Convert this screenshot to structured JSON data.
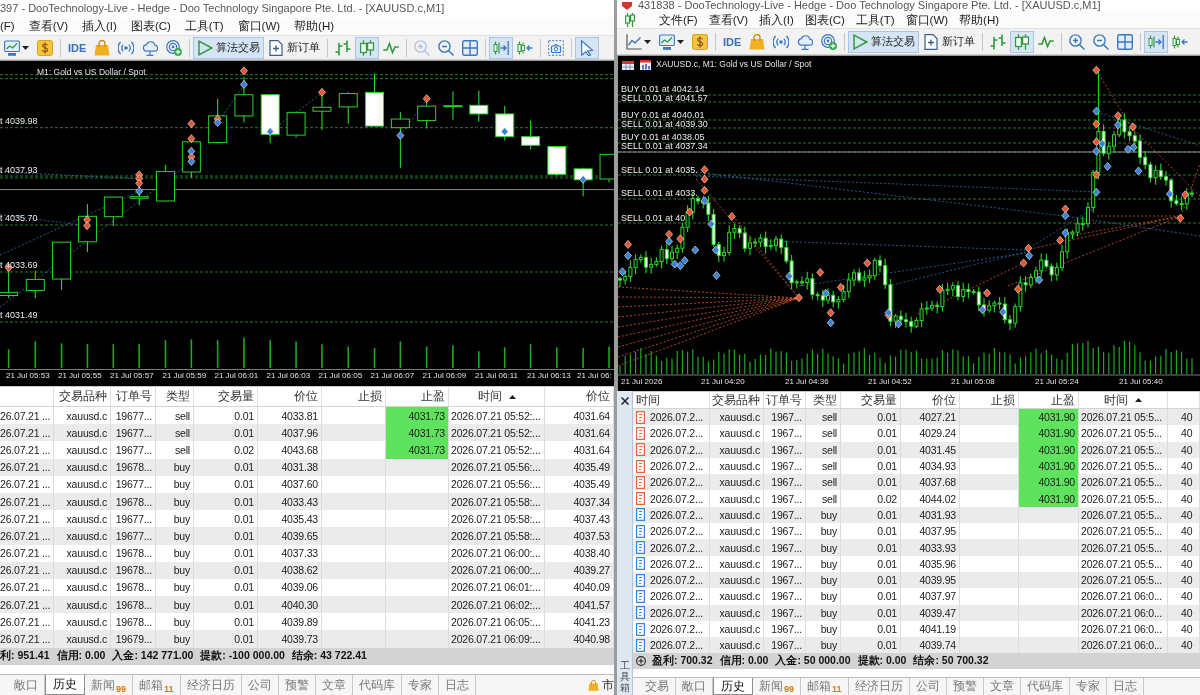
{
  "left_window": {
    "title": "397 - DooTechnology-Live - Hedge - Doo Technology Singapore Pte. Ltd. - [XAUUSD.c,M1]",
    "menu": [
      "(F)",
      "查看(V)",
      "插入(I)",
      "图表(C)",
      "工具(T)",
      "窗口(W)",
      "帮助(H)"
    ],
    "toolbar": [
      [
        {
          "selected": false,
          "disabled": false
        },
        {
          "selected": false,
          "disabled": false
        }
      ],
      [
        {
          "label": "IDE",
          "selected": false,
          "disabled": false
        },
        {
          "selected": false,
          "disabled": false
        },
        {
          "selected": false,
          "disabled": false
        },
        {
          "selected": false,
          "disabled": false
        },
        {
          "selected": false,
          "disabled": false
        }
      ],
      [
        {
          "label": "算法交易",
          "selected": true,
          "disabled": false
        },
        {
          "label": "新订单",
          "selected": false,
          "disabled": false
        }
      ],
      [
        {
          "selected": false,
          "disabled": false
        },
        {
          "selected": true,
          "disabled": false
        },
        {
          "selected": false,
          "disabled": false
        }
      ],
      [
        {
          "selected": false,
          "disabled": true
        },
        {
          "selected": false,
          "disabled": false
        },
        {
          "selected": false,
          "disabled": false
        }
      ],
      [
        {
          "selected": true,
          "disabled": false
        },
        {
          "selected": false,
          "disabled": false
        }
      ],
      [
        {
          "selected": false,
          "disabled": false
        }
      ],
      [
        {
          "selected": true,
          "disabled": false
        }
      ]
    ],
    "chart": {
      "title": "M1: Gold vs US Dollar / Spot",
      "order_labels": [
        "t 4039.98",
        "t 4037.93",
        "t 4035.70",
        "t 4033.69",
        "t 4031.49"
      ],
      "time_labels": [
        "21 Jul 05:53",
        "21 Jul 05:55",
        "21 Jul 05:57",
        "21 Jul 05:59",
        "21 Jul 06:01",
        "21 Jul 06:03",
        "21 Jul 06:05",
        "21 Jul 06:07",
        "21 Jul 06:09",
        "21 Jul 06:11",
        "21 Jul 06:13",
        "21 Jul 06:"
      ]
    },
    "table": {
      "columns": [
        {
          "sorted": false
        },
        {
          "label": "交易品种",
          "sorted": false
        },
        {
          "label": "订单号",
          "sorted": false
        },
        {
          "label": "类型",
          "sorted": false
        },
        {
          "label": "交易量",
          "sorted": false
        },
        {
          "label": "价位",
          "sorted": false
        },
        {
          "label": "止损",
          "sorted": false
        },
        {
          "label": "止盈",
          "sorted": false
        },
        {
          "label": "时间",
          "sorted": true
        },
        {
          "label": "价位",
          "sorted": false
        }
      ],
      "rows": [
        {
          "time": "26.07.21 ...",
          "symbol": "xauusd.c",
          "order": "19677...",
          "type": "sell",
          "volume": "0.01",
          "price": "4033.81",
          "take_profit": "4031.73",
          "tp_highlighted": true,
          "close_time": "2026.07.21 05:52:...",
          "close_price": "4031.64"
        },
        {
          "time": "26.07.21 ...",
          "symbol": "xauusd.c",
          "order": "19677...",
          "type": "sell",
          "volume": "0.01",
          "price": "4037.96",
          "take_profit": "4031.73",
          "tp_highlighted": true,
          "close_time": "2026.07.21 05:52:...",
          "close_price": "4031.64"
        },
        {
          "time": "26.07.21 ...",
          "symbol": "xauusd.c",
          "order": "19677...",
          "type": "sell",
          "volume": "0.02",
          "price": "4043.68",
          "take_profit": "4031.73",
          "tp_highlighted": true,
          "close_time": "2026.07.21 05:52:...",
          "close_price": "4031.64"
        },
        {
          "time": "26.07.21 ...",
          "symbol": "xauusd.c",
          "order": "19678...",
          "type": "buy",
          "volume": "0.01",
          "price": "4031.38",
          "tp_highlighted": false,
          "close_time": "2026.07.21 05:56:...",
          "close_price": "4035.49"
        },
        {
          "time": "26.07.21 ...",
          "symbol": "xauusd.c",
          "order": "19677...",
          "type": "buy",
          "volume": "0.01",
          "price": "4037.60",
          "tp_highlighted": false,
          "close_time": "2026.07.21 05:56:...",
          "close_price": "4035.49"
        },
        {
          "time": "26.07.21 ...",
          "symbol": "xauusd.c",
          "order": "19678...",
          "type": "buy",
          "volume": "0.01",
          "price": "4033.43",
          "tp_highlighted": false,
          "close_time": "2026.07.21 05:58:...",
          "close_price": "4037.34"
        },
        {
          "time": "26.07.21 ...",
          "symbol": "xauusd.c",
          "order": "19677...",
          "type": "buy",
          "volume": "0.01",
          "price": "4035.43",
          "tp_highlighted": false,
          "close_time": "2026.07.21 05:58:...",
          "close_price": "4037.43"
        },
        {
          "time": "26.07.21 ...",
          "symbol": "xauusd.c",
          "order": "19677...",
          "type": "buy",
          "volume": "0.01",
          "price": "4039.65",
          "tp_highlighted": false,
          "close_time": "2026.07.21 05:58:...",
          "close_price": "4037.53"
        },
        {
          "time": "26.07.21 ...",
          "symbol": "xauusd.c",
          "order": "19678...",
          "type": "buy",
          "volume": "0.01",
          "price": "4037.33",
          "tp_highlighted": false,
          "close_time": "2026.07.21 06:00:...",
          "close_price": "4038.40"
        },
        {
          "time": "26.07.21 ...",
          "symbol": "xauusd.c",
          "order": "19678...",
          "type": "buy",
          "volume": "0.01",
          "price": "4038.62",
          "tp_highlighted": false,
          "close_time": "2026.07.21 06:00:...",
          "close_price": "4039.27"
        },
        {
          "time": "26.07.21 ...",
          "symbol": "xauusd.c",
          "order": "19678...",
          "type": "buy",
          "volume": "0.01",
          "price": "4039.06",
          "tp_highlighted": false,
          "close_time": "2026.07.21 06:01:...",
          "close_price": "4040.09"
        },
        {
          "time": "26.07.21 ...",
          "symbol": "xauusd.c",
          "order": "19678...",
          "type": "buy",
          "volume": "0.01",
          "price": "4040.30",
          "tp_highlighted": false,
          "close_time": "2026.07.21 06:02:...",
          "close_price": "4041.57"
        },
        {
          "time": "26.07.21 ...",
          "symbol": "xauusd.c",
          "order": "19678...",
          "type": "buy",
          "volume": "0.01",
          "price": "4039.89",
          "tp_highlighted": false,
          "close_time": "2026.07.21 06:05:...",
          "close_price": "4041.23"
        },
        {
          "time": "26.07.21 ...",
          "symbol": "xauusd.c",
          "order": "19679...",
          "type": "buy",
          "volume": "0.01",
          "price": "4039.73",
          "tp_highlighted": false,
          "close_time": "2026.07.21 06:09:...",
          "close_price": "4040.98"
        }
      ],
      "summary": [
        "利: 951.41",
        "信用: 0.00",
        "入金: 142 771.00",
        "提款: -100 000.00",
        "结余: 43 722.41"
      ]
    },
    "tabs": [
      {
        "label": "敞口",
        "selected": false
      },
      {
        "label": "历史",
        "selected": true
      },
      {
        "label": "新闻",
        "badge": "99",
        "selected": false
      },
      {
        "label": "邮箱",
        "badge": "11",
        "selected": false
      },
      {
        "label": "经济日历",
        "selected": false
      },
      {
        "label": "公司",
        "selected": false
      },
      {
        "label": "预警",
        "selected": false
      },
      {
        "label": "文章",
        "selected": false
      },
      {
        "label": "代码库",
        "selected": false
      },
      {
        "label": "专家",
        "selected": false
      },
      {
        "label": "日志",
        "selected": false
      }
    ],
    "status": "市"
  },
  "right_window": {
    "title": "431838 - DooTechnology-Live - Hedge - Doo Technology Singapore Pte. Ltd. - [XAUUSD.c,M1]",
    "menu": [
      "文件(F)",
      "查看(V)",
      "插入(I)",
      "图表(C)",
      "工具(T)",
      "窗口(W)",
      "帮助(H)"
    ],
    "toolbar": [
      [
        {
          "selected": false,
          "disabled": false
        },
        {
          "selected": false,
          "disabled": false
        },
        {
          "selected": false,
          "disabled": false
        }
      ],
      [
        {
          "label": "IDE",
          "selected": false,
          "disabled": false
        },
        {
          "selected": false,
          "disabled": false
        },
        {
          "selected": false,
          "disabled": false
        },
        {
          "selected": false,
          "disabled": false
        },
        {
          "selected": false,
          "disabled": false
        }
      ],
      [
        {
          "label": "算法交易",
          "selected": true,
          "disabled": false
        },
        {
          "label": "新订单",
          "selected": false,
          "disabled": false
        }
      ],
      [
        {
          "selected": false,
          "disabled": false
        },
        {
          "selected": true,
          "disabled": false
        },
        {
          "selected": false,
          "disabled": false
        }
      ],
      [
        {
          "selected": false,
          "disabled": false
        },
        {
          "selected": false,
          "disabled": false
        },
        {
          "selected": false,
          "disabled": false
        }
      ],
      [
        {
          "selected": true,
          "disabled": false
        },
        {
          "selected": false,
          "disabled": false
        }
      ]
    ],
    "chart": {
      "title": "XAUUSD.c, M1: Gold vs US Dollar / Spot",
      "order_labels": [
        "BUY 0.01 at 4042.14",
        "SELL 0.01 at 4041.57",
        "BUY 0.01 at 4040.01",
        "SELL 0.01 at 4039.30",
        "BUY 0.01 at 4038.05",
        "SELL 0.01 at 4037.34",
        "SELL 0.01 at 4035.",
        "SELL 0.01 at 4033.",
        "SELL 0.01 at 40"
      ],
      "time_labels": [
        "21 Jul 2026",
        "21 Jul 04:20",
        "21 Jul 04:36",
        "21 Jul 04:52",
        "21 Jul 05:08",
        "21 Jul 05:24",
        "21 Jul 05:40"
      ]
    },
    "table": {
      "columns": [
        {
          "label": "时间",
          "sorted": false
        },
        {
          "label": "交易品种",
          "sorted": false
        },
        {
          "label": "订单号",
          "sorted": false
        },
        {
          "label": "类型",
          "sorted": false
        },
        {
          "label": "交易量",
          "sorted": false
        },
        {
          "label": "价位",
          "sorted": false
        },
        {
          "label": "止损",
          "sorted": false
        },
        {
          "label": "止盈",
          "sorted": false
        },
        {
          "label": "时间",
          "sorted": true
        },
        {
          "sorted": false
        }
      ],
      "rows": [
        {
          "kind": "sell",
          "time": "2026.07.2...",
          "symbol": "xauusd.c",
          "order": "1967...",
          "type": "sell",
          "volume": "0.01",
          "price": "4027.21",
          "take_profit": "4031.90",
          "tp_highlighted": true,
          "close_time": "2026.07.21 05:5...",
          "close_price": "40"
        },
        {
          "kind": "sell",
          "time": "2026.07.2...",
          "symbol": "xauusd.c",
          "order": "1967...",
          "type": "sell",
          "volume": "0.01",
          "price": "4029.24",
          "take_profit": "4031.90",
          "tp_highlighted": true,
          "close_time": "2026.07.21 05:5...",
          "close_price": "40"
        },
        {
          "kind": "sell",
          "time": "2026.07.2...",
          "symbol": "xauusd.c",
          "order": "1967...",
          "type": "sell",
          "volume": "0.01",
          "price": "4031.45",
          "take_profit": "4031.90",
          "tp_highlighted": true,
          "close_time": "2026.07.21 05:5...",
          "close_price": "40"
        },
        {
          "kind": "sell",
          "time": "2026.07.2...",
          "symbol": "xauusd.c",
          "order": "1967...",
          "type": "sell",
          "volume": "0.01",
          "price": "4034.93",
          "take_profit": "4031.90",
          "tp_highlighted": true,
          "close_time": "2026.07.21 05:5...",
          "close_price": "40"
        },
        {
          "kind": "sell",
          "time": "2026.07.2...",
          "symbol": "xauusd.c",
          "order": "1967...",
          "type": "sell",
          "volume": "0.01",
          "price": "4037.68",
          "take_profit": "4031.90",
          "tp_highlighted": true,
          "close_time": "2026.07.21 05:5...",
          "close_price": "40"
        },
        {
          "kind": "sell",
          "time": "2026.07.2...",
          "symbol": "xauusd.c",
          "order": "1967...",
          "type": "sell",
          "volume": "0.02",
          "price": "4044.02",
          "take_profit": "4031.90",
          "tp_highlighted": true,
          "close_time": "2026.07.21 05:5...",
          "close_price": "40"
        },
        {
          "kind": "buy",
          "time": "2026.07.2...",
          "symbol": "xauusd.c",
          "order": "1967...",
          "type": "buy",
          "volume": "0.01",
          "price": "4031.93",
          "tp_highlighted": false,
          "close_time": "2026.07.21 05:5...",
          "close_price": "40"
        },
        {
          "kind": "buy",
          "time": "2026.07.2...",
          "symbol": "xauusd.c",
          "order": "1967...",
          "type": "buy",
          "volume": "0.01",
          "price": "4037.95",
          "tp_highlighted": false,
          "close_time": "2026.07.21 05:5...",
          "close_price": "40"
        },
        {
          "kind": "buy",
          "time": "2026.07.2...",
          "symbol": "xauusd.c",
          "order": "1967...",
          "type": "buy",
          "volume": "0.01",
          "price": "4033.93",
          "tp_highlighted": false,
          "close_time": "2026.07.21 05:5...",
          "close_price": "40"
        },
        {
          "kind": "buy",
          "time": "2026.07.2...",
          "symbol": "xauusd.c",
          "order": "1967...",
          "type": "buy",
          "volume": "0.01",
          "price": "4035.96",
          "tp_highlighted": false,
          "close_time": "2026.07.21 05:5...",
          "close_price": "40"
        },
        {
          "kind": "buy",
          "time": "2026.07.2...",
          "symbol": "xauusd.c",
          "order": "1967...",
          "type": "buy",
          "volume": "0.01",
          "price": "4039.95",
          "tp_highlighted": false,
          "close_time": "2026.07.21 05:5...",
          "close_price": "40"
        },
        {
          "kind": "buy",
          "time": "2026.07.2...",
          "symbol": "xauusd.c",
          "order": "1967...",
          "type": "buy",
          "volume": "0.01",
          "price": "4037.97",
          "tp_highlighted": false,
          "close_time": "2026.07.21 06:0...",
          "close_price": "40"
        },
        {
          "kind": "buy",
          "time": "2026.07.2...",
          "symbol": "xauusd.c",
          "order": "1967...",
          "type": "buy",
          "volume": "0.01",
          "price": "4039.47",
          "tp_highlighted": false,
          "close_time": "2026.07.21 06:0...",
          "close_price": "40"
        },
        {
          "kind": "buy",
          "time": "2026.07.2...",
          "symbol": "xauusd.c",
          "order": "1967...",
          "type": "buy",
          "volume": "0.01",
          "price": "4041.19",
          "tp_highlighted": false,
          "close_time": "2026.07.21 06:0...",
          "close_price": "40"
        },
        {
          "kind": "buy",
          "time": "2026.07.2...",
          "symbol": "xauusd.c",
          "order": "1967...",
          "type": "buy",
          "volume": "0.01",
          "price": "4039.74",
          "tp_highlighted": false,
          "close_time": "2026.07.21 06:0...",
          "close_price": "40"
        }
      ],
      "summary": [
        "盈利: 700.32",
        "信用: 0.00",
        "入金: 50 000.00",
        "提款: 0.00",
        "结余: 50 700.32"
      ]
    },
    "tabs": [
      {
        "label": "交易",
        "selected": false
      },
      {
        "label": "敞口",
        "selected": false
      },
      {
        "label": "历史",
        "selected": true
      },
      {
        "label": "新闻",
        "badge": "99",
        "selected": false
      },
      {
        "label": "邮箱",
        "badge": "11",
        "selected": false
      },
      {
        "label": "经济日历",
        "selected": false
      },
      {
        "label": "公司",
        "selected": false
      },
      {
        "label": "预警",
        "selected": false
      },
      {
        "label": "文章",
        "selected": false
      },
      {
        "label": "代码库",
        "selected": false
      },
      {
        "label": "专家",
        "selected": false
      },
      {
        "label": "日志",
        "selected": false
      }
    ],
    "toolbox": "工具箱"
  }
}
